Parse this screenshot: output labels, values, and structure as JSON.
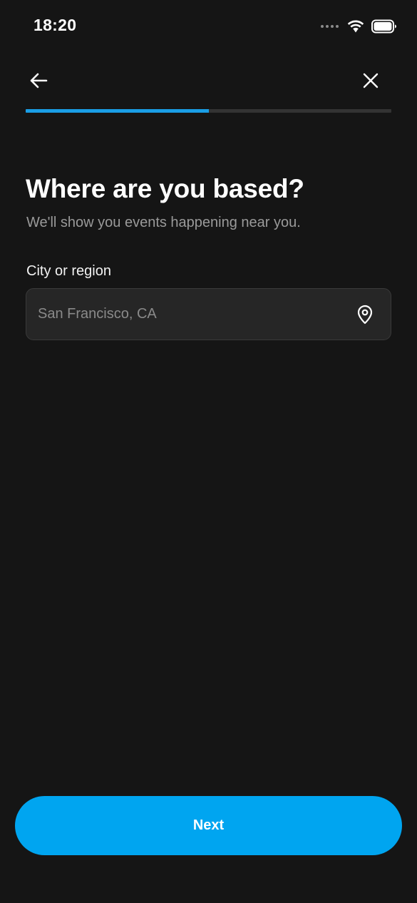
{
  "status_bar": {
    "time": "18:20",
    "icons": [
      "signal-dots-icon",
      "wifi-icon",
      "battery-icon"
    ]
  },
  "nav": {
    "back_icon": "arrow-left-icon",
    "close_icon": "close-icon"
  },
  "progress": {
    "fraction": 0.5,
    "accent_color": "#1a9ee6",
    "track_color": "#333333"
  },
  "header": {
    "title": "Where are you based?",
    "subtitle": "We'll show you events happening near you."
  },
  "location_field": {
    "label": "City or region",
    "value": "",
    "placeholder": "San Francisco, CA",
    "icon": "map-pin-icon"
  },
  "footer": {
    "next_label": "Next",
    "button_color": "#00a5f0"
  },
  "theme": {
    "background": "#151515"
  }
}
